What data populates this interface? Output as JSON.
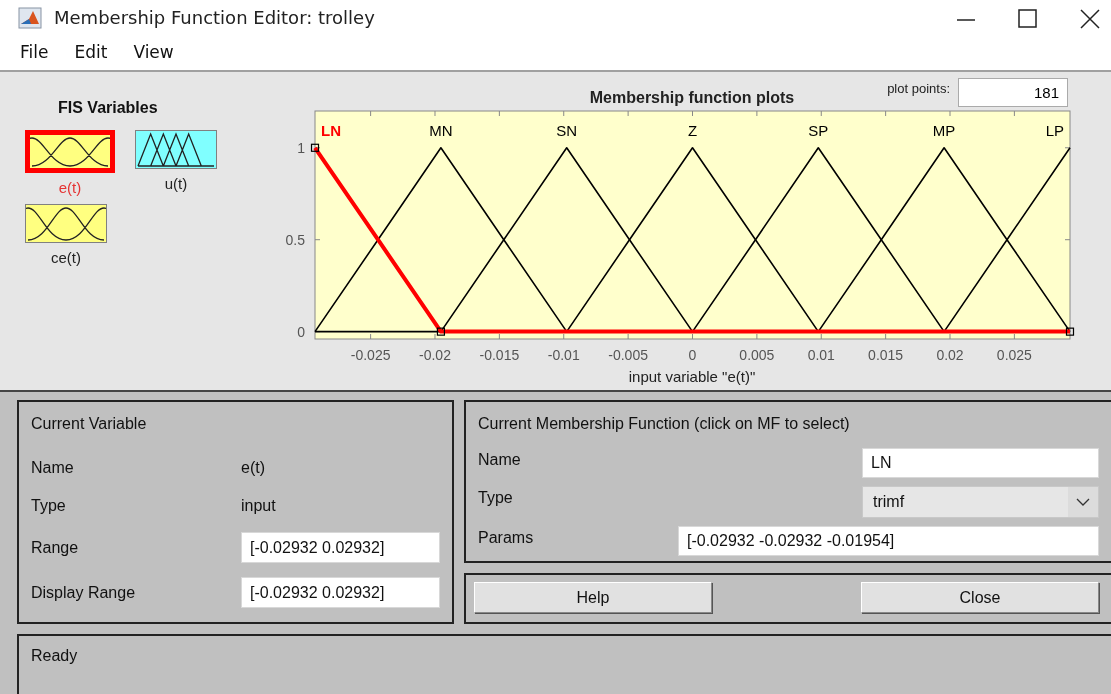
{
  "window": {
    "title": "Membership Function Editor: trolley"
  },
  "menu": [
    "File",
    "Edit",
    "View"
  ],
  "fis_variables": {
    "title": "FIS Variables",
    "items": [
      {
        "name": "e(t)",
        "kind": "input",
        "selected": true
      },
      {
        "name": "u(t)",
        "kind": "output",
        "selected": false
      },
      {
        "name": "ce(t)",
        "kind": "input",
        "selected": false
      }
    ]
  },
  "plot": {
    "plot_points_label": "plot points:",
    "plot_points": "181",
    "chart_data": {
      "type": "line",
      "title": "Membership function plots",
      "xlabel": "input variable \"e(t)\"",
      "x": [
        -0.02932,
        -0.02443,
        -0.01954,
        -0.01466,
        -0.00977,
        -0.00489,
        0,
        0.00489,
        0.00977,
        0.01466,
        0.01954,
        0.02443,
        0.02932
      ],
      "series": [
        {
          "name": "LN",
          "color": "#ff0000",
          "values": [
            1,
            0.5,
            0,
            0,
            0,
            0,
            0,
            0,
            0,
            0,
            0,
            0,
            0
          ]
        },
        {
          "name": "MN",
          "color": "#000000",
          "values": [
            0,
            0.5,
            1,
            0.5,
            0,
            null,
            null,
            null,
            null,
            null,
            null,
            null,
            null
          ]
        },
        {
          "name": "SN",
          "color": "#000000",
          "values": [
            0,
            0,
            0,
            0.5,
            1,
            0.5,
            0,
            null,
            null,
            null,
            null,
            null,
            null
          ]
        },
        {
          "name": "Z",
          "color": "#000000",
          "values": [
            null,
            null,
            null,
            null,
            0,
            0.5,
            1,
            0.5,
            0,
            null,
            null,
            null,
            null
          ]
        },
        {
          "name": "SP",
          "color": "#000000",
          "values": [
            null,
            null,
            null,
            null,
            null,
            null,
            0,
            0.5,
            1,
            0.5,
            0,
            null,
            null
          ]
        },
        {
          "name": "MP",
          "color": "#000000",
          "values": [
            null,
            null,
            null,
            null,
            null,
            null,
            null,
            null,
            0,
            0.5,
            1,
            0.5,
            0
          ]
        },
        {
          "name": "LP",
          "color": "#000000",
          "values": [
            null,
            null,
            null,
            null,
            null,
            null,
            null,
            null,
            null,
            null,
            0,
            0.5,
            1
          ]
        }
      ],
      "xlim": [
        -0.02932,
        0.02932
      ],
      "ylim": [
        -0.04,
        1.2
      ],
      "xticks": [
        -0.025,
        -0.02,
        -0.015,
        -0.01,
        -0.005,
        0,
        0.005,
        0.01,
        0.015,
        0.02,
        0.025
      ],
      "yticks": [
        0,
        0.5,
        1
      ]
    }
  },
  "current_variable": {
    "title": "Current Variable",
    "name_label": "Name",
    "name": "e(t)",
    "type_label": "Type",
    "type": "input",
    "range_label": "Range",
    "range": "[-0.02932 0.02932]",
    "display_range_label": "Display Range",
    "display_range": "[-0.02932 0.02932]"
  },
  "current_mf": {
    "title": "Current Membership Function (click on MF to select)",
    "name_label": "Name",
    "name": "LN",
    "type_label": "Type",
    "type": "trimf",
    "params_label": "Params",
    "params": "[-0.02932 -0.02932 -0.01954]"
  },
  "buttons": [
    "Help",
    "Close"
  ],
  "status_bar": "Ready"
}
